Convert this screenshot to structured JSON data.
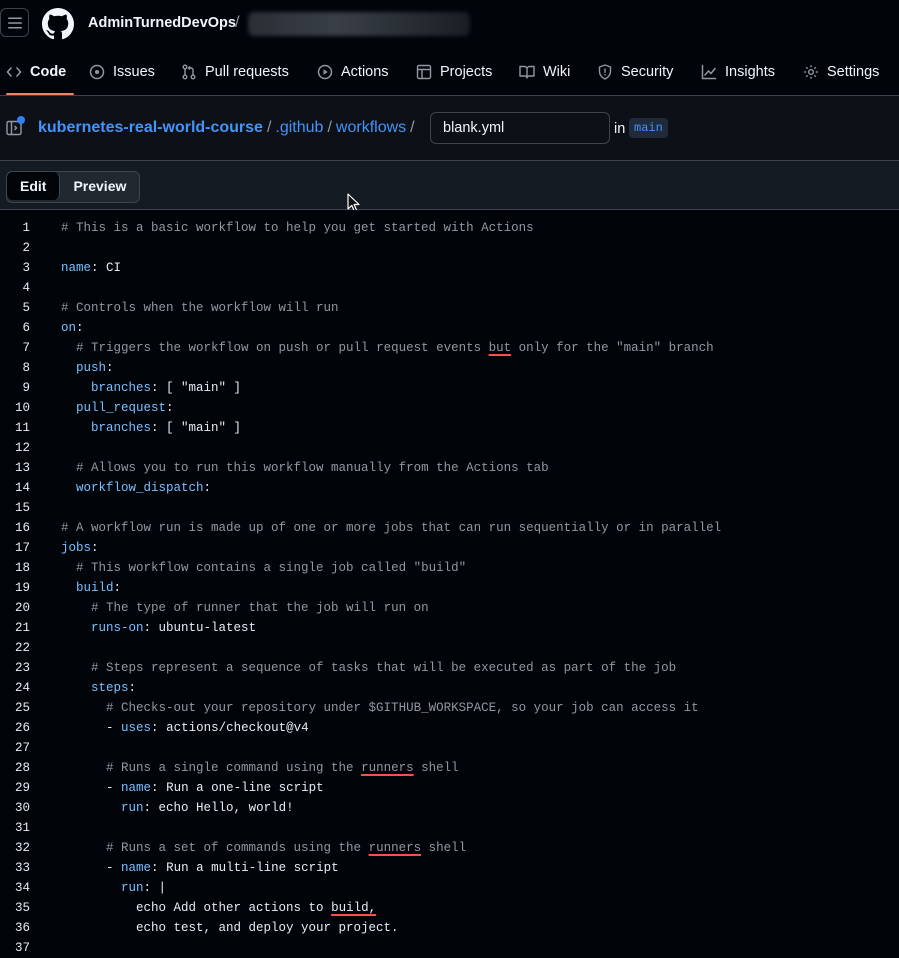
{
  "header": {
    "owner": "AdminTurnedDevOps",
    "slash": "/"
  },
  "nav": [
    {
      "name": "code",
      "label": "Code",
      "icon": "code-icon",
      "active": true
    },
    {
      "name": "issues",
      "label": "Issues",
      "icon": "issue-icon"
    },
    {
      "name": "pull-requests",
      "label": "Pull requests",
      "icon": "pull-request-icon"
    },
    {
      "name": "actions",
      "label": "Actions",
      "icon": "play-icon"
    },
    {
      "name": "projects",
      "label": "Projects",
      "icon": "table-icon"
    },
    {
      "name": "wiki",
      "label": "Wiki",
      "icon": "book-icon"
    },
    {
      "name": "security",
      "label": "Security",
      "icon": "shield-icon"
    },
    {
      "name": "insights",
      "label": "Insights",
      "icon": "graph-icon"
    },
    {
      "name": "settings",
      "label": "Settings",
      "icon": "gear-icon"
    }
  ],
  "path": {
    "repo": "kubernetes-real-world-course",
    "dir1": ".github",
    "dir2": "workflows",
    "sep": "/",
    "filename": "blank.yml",
    "in_label": "in",
    "branch": "main"
  },
  "editbar": {
    "edit_label": "Edit",
    "preview_label": "Preview"
  },
  "editor": {
    "lines": [
      "# This is a basic workflow to help you get started with Actions",
      "",
      "name: CI",
      "",
      "# Controls when the workflow will run",
      "on:",
      "  # Triggers the workflow on push or pull request events but only for the \"main\" branch",
      "  push:",
      "    branches: [ \"main\" ]",
      "  pull_request:",
      "    branches: [ \"main\" ]",
      "",
      "  # Allows you to run this workflow manually from the Actions tab",
      "  workflow_dispatch:",
      "",
      "# A workflow run is made up of one or more jobs that can run sequentially or in parallel",
      "jobs:",
      "  # This workflow contains a single job called \"build\"",
      "  build:",
      "    # The type of runner that the job will run on",
      "    runs-on: ubuntu-latest",
      "",
      "    # Steps represent a sequence of tasks that will be executed as part of the job",
      "    steps:",
      "      # Checks-out your repository under $GITHUB_WORKSPACE, so your job can access it",
      "      - uses: actions/checkout@v4",
      "",
      "      # Runs a single command using the runners shell",
      "      - name: Run a one-line script",
      "        run: echo Hello, world!",
      "",
      "      # Runs a set of commands using the runners shell",
      "      - name: Run a multi-line script",
      "        run: |",
      "          echo Add other actions to build,",
      "          echo test, and deploy your project.",
      ""
    ],
    "misspelled": {
      "7": "but",
      "28": "runners",
      "32": "runners",
      "35": "build,"
    }
  }
}
